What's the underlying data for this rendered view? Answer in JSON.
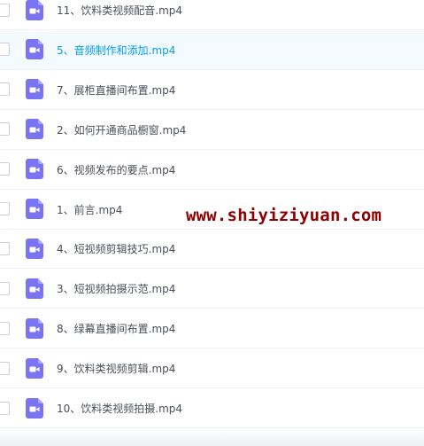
{
  "files": [
    {
      "name": "11、饮料类视频配音.mp4",
      "icon": "video-file-icon",
      "selected": false
    },
    {
      "name": "5、音频制作和添加.mp4",
      "icon": "video-file-icon",
      "selected": true
    },
    {
      "name": "7、展柜直播间布置.mp4",
      "icon": "video-file-icon",
      "selected": false
    },
    {
      "name": "2、如何开通商品橱窗.mp4",
      "icon": "video-file-icon",
      "selected": false
    },
    {
      "name": "6、视频发布的要点.mp4",
      "icon": "video-file-icon",
      "selected": false
    },
    {
      "name": "1、前言.mp4",
      "icon": "video-file-icon",
      "selected": false
    },
    {
      "name": "4、短视频剪辑技巧.mp4",
      "icon": "video-file-icon",
      "selected": false
    },
    {
      "name": "3、短视频拍摄示范.mp4",
      "icon": "video-file-icon",
      "selected": false
    },
    {
      "name": "8、绿幕直播间布置.mp4",
      "icon": "video-file-icon",
      "selected": false
    },
    {
      "name": "9、饮料类视频剪辑.mp4",
      "icon": "video-file-icon",
      "selected": false
    },
    {
      "name": "10、饮料类视频拍摄.mp4",
      "icon": "video-file-icon",
      "selected": false
    }
  ],
  "watermark": "www.shiyiziyuan.com",
  "colors": {
    "icon": "#7b74f2",
    "selected_text": "#08a0ea",
    "selected_row": "#f4fbff",
    "text": "#4a4f5a",
    "watermark": "#8b0000"
  }
}
